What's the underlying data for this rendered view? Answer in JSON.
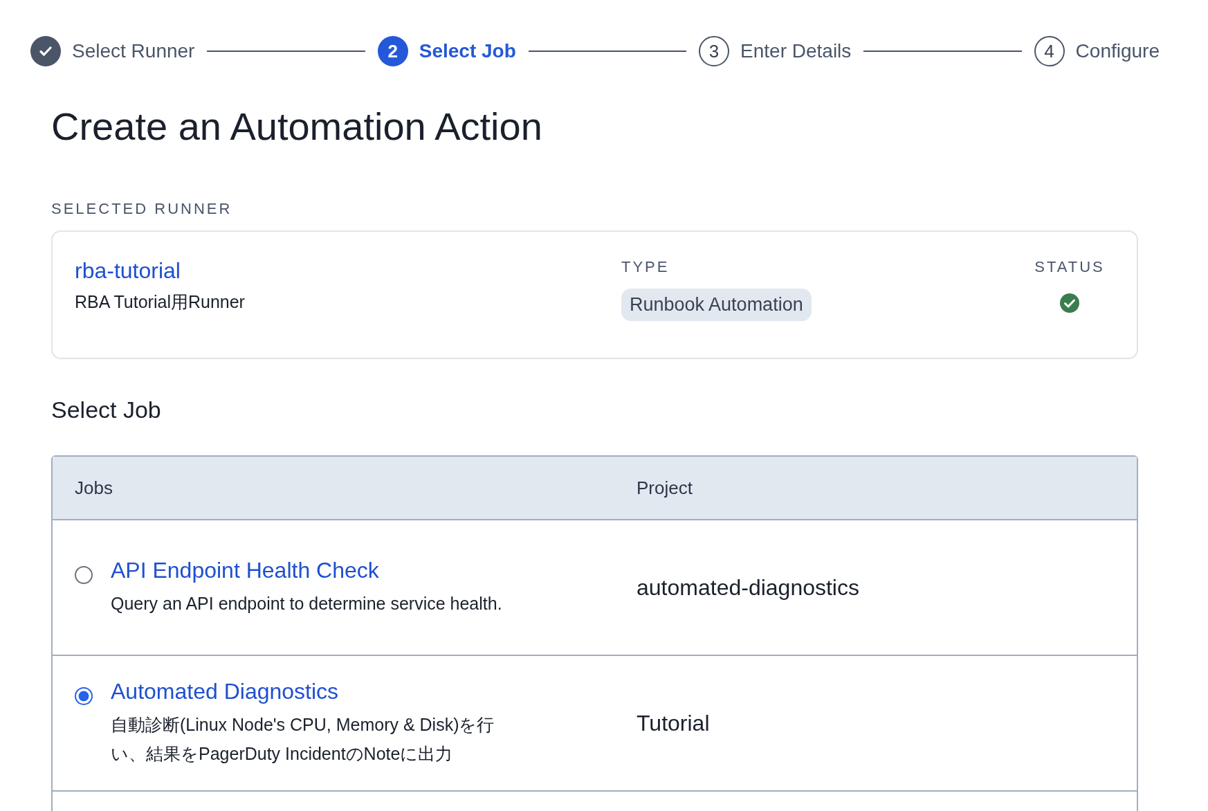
{
  "steps": [
    {
      "label": "Select Runner",
      "completed": true,
      "selected": false
    },
    {
      "label": "Select Job",
      "number": "2",
      "completed": false,
      "selected": true
    },
    {
      "label": "Enter Details",
      "number": "3",
      "completed": false,
      "selected": false
    },
    {
      "label": "Configure",
      "number": "4",
      "completed": false,
      "selected": false
    }
  ],
  "title": "Create an Automation Action",
  "runner_section": {
    "label": "SELECTED RUNNER",
    "name": "rba-tutorial",
    "description": "RBA Tutorial用Runner",
    "type_label": "TYPE",
    "type": "Runbook Automation",
    "status_label": "STATUS",
    "online": true
  },
  "job_heading": "Select Job",
  "table": {
    "columns": [
      "Jobs",
      "Project"
    ],
    "rows": [
      {
        "name": "API Endpoint Health Check",
        "description": "Query an API endpoint to determine service health.",
        "project": "automated-diagnostics",
        "selected": false
      },
      {
        "name": "Automated Diagnostics",
        "description": "自動診断(Linux Node's CPU, Memory & Disk)を行い、結果をPagerDuty IncidentのNoteに出力",
        "project": "Tutorial",
        "selected": true
      }
    ]
  }
}
